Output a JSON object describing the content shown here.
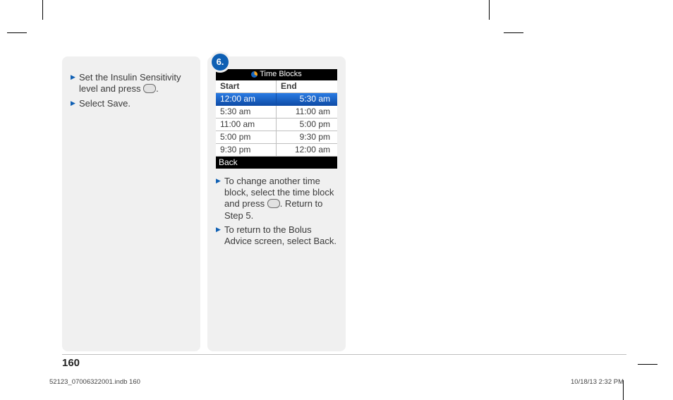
{
  "page_number": "160",
  "meta": {
    "left": "52123_07006322001.indb   160",
    "right": "10/18/13   2:32 PM"
  },
  "card_left": {
    "bullets": [
      "Set the Insulin Sensitivity level and press [BTN].",
      "Select Save."
    ]
  },
  "card_right": {
    "step_label": "6.",
    "device": {
      "title": "Time Blocks",
      "headers": {
        "start": "Start",
        "end": "End"
      },
      "rows": [
        {
          "start": "12:00 am",
          "end": "5:30 am",
          "selected": true
        },
        {
          "start": "5:30 am",
          "end": "11:00 am",
          "selected": false
        },
        {
          "start": "11:00 am",
          "end": "5:00 pm",
          "selected": false
        },
        {
          "start": "5:00 pm",
          "end": "9:30 pm",
          "selected": false
        },
        {
          "start": "9:30 pm",
          "end": "12:00 am",
          "selected": false
        }
      ],
      "footer": "Back"
    },
    "bullets": [
      "To change another time block, select the time block and press [BTN]. Return to Step 5.",
      "To return to the Bolus Advice screen, select Back."
    ]
  }
}
